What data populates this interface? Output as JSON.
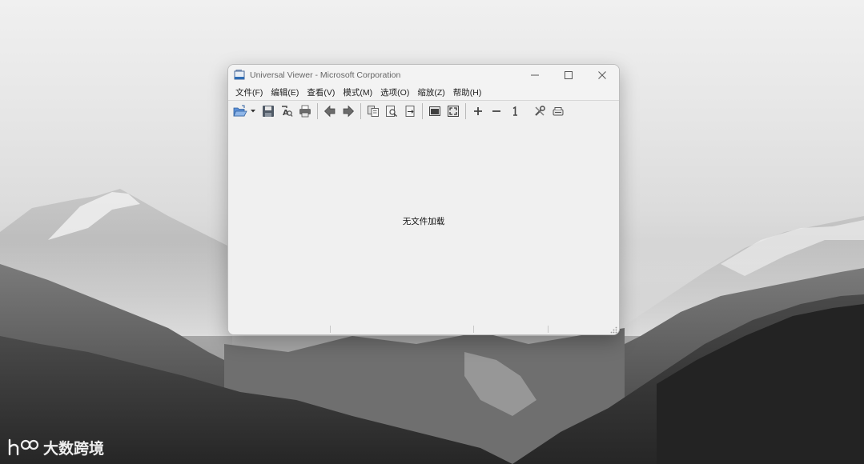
{
  "window": {
    "title": "Universal Viewer - Microsoft Corporation",
    "controls": {
      "minimize_icon": "minimize-icon",
      "maximize_icon": "maximize-icon",
      "close_icon": "close-icon"
    }
  },
  "menu": {
    "items": [
      {
        "label": "文件(F)"
      },
      {
        "label": "编辑(E)"
      },
      {
        "label": "查看(V)"
      },
      {
        "label": "模式(M)"
      },
      {
        "label": "选项(O)"
      },
      {
        "label": "缩放(Z)"
      },
      {
        "label": "帮助(H)"
      }
    ]
  },
  "toolbar": {
    "icons": [
      "open-folder-icon",
      "save-icon",
      "find-icon",
      "print-icon",
      "prev-file-icon",
      "next-file-icon",
      "copy-icon",
      "preview-icon",
      "copy-to-file-icon",
      "fit-window-icon",
      "fullscreen-icon",
      "zoom-in-icon",
      "zoom-out-icon",
      "original-size-icon",
      "settings-icon",
      "exit-icon"
    ]
  },
  "content": {
    "empty_message": "无文件加载"
  },
  "watermark": {
    "text": "大数跨境"
  },
  "colors": {
    "window_bg": "#f0f0f0",
    "accent": "#2f6db5"
  }
}
